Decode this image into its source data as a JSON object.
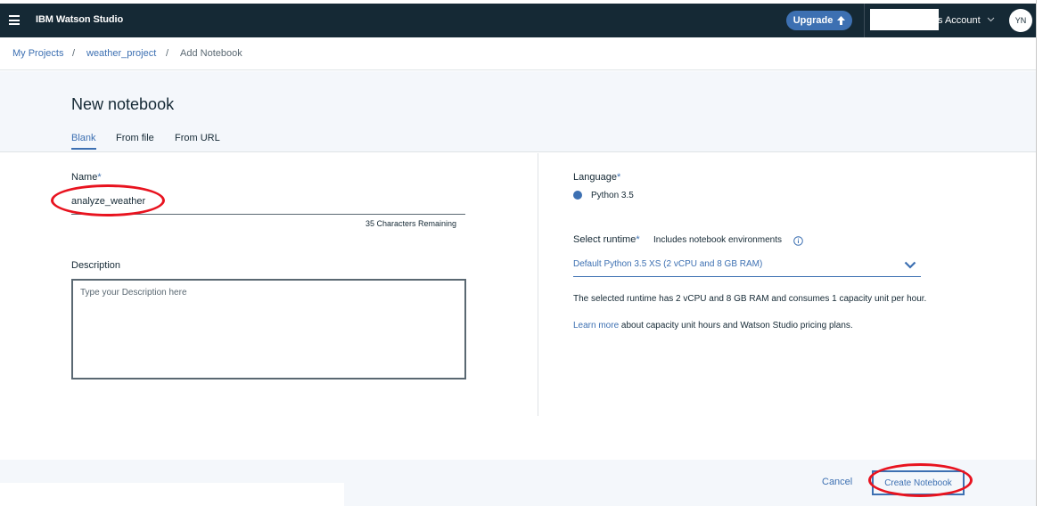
{
  "topbar": {
    "brand": "IBM Watson Studio",
    "upgrade_label": "Upgrade",
    "account_label": "s Account",
    "avatar_initials": "YN"
  },
  "breadcrumb": {
    "items": [
      "My Projects",
      "weather_project",
      "Add Notebook"
    ],
    "separator": "/"
  },
  "header": {
    "title": "New notebook",
    "tabs": [
      {
        "label": "Blank",
        "active": true
      },
      {
        "label": "From file",
        "active": false
      },
      {
        "label": "From URL",
        "active": false
      }
    ]
  },
  "form": {
    "name": {
      "label": "Name",
      "required_mark": "*",
      "value": "analyze_weather",
      "chars_remaining": "35 Characters Remaining"
    },
    "description": {
      "label": "Description",
      "placeholder": "Type your Description here"
    },
    "language": {
      "label": "Language",
      "required_mark": "*",
      "value": "Python 3.5"
    },
    "runtime": {
      "label": "Select runtime",
      "required_mark": "*",
      "hint": "Includes notebook environments",
      "selected": "Default Python 3.5 XS (2 vCPU and 8 GB RAM)",
      "note": "The selected runtime has 2 vCPU and 8 GB RAM and consumes 1 capacity unit per hour.",
      "learn_more_link": "Learn more",
      "learn_more_rest": " about capacity unit hours and Watson Studio pricing plans."
    }
  },
  "footer": {
    "cancel_label": "Cancel",
    "create_label": "Create Notebook"
  },
  "colors": {
    "topbar_bg": "#152935",
    "accent": "#3d70b2",
    "annotation": "#e8131f"
  },
  "icons": [
    "hamburger-menu-icon",
    "upload-arrow-icon",
    "chevron-down-icon",
    "info-icon"
  ]
}
